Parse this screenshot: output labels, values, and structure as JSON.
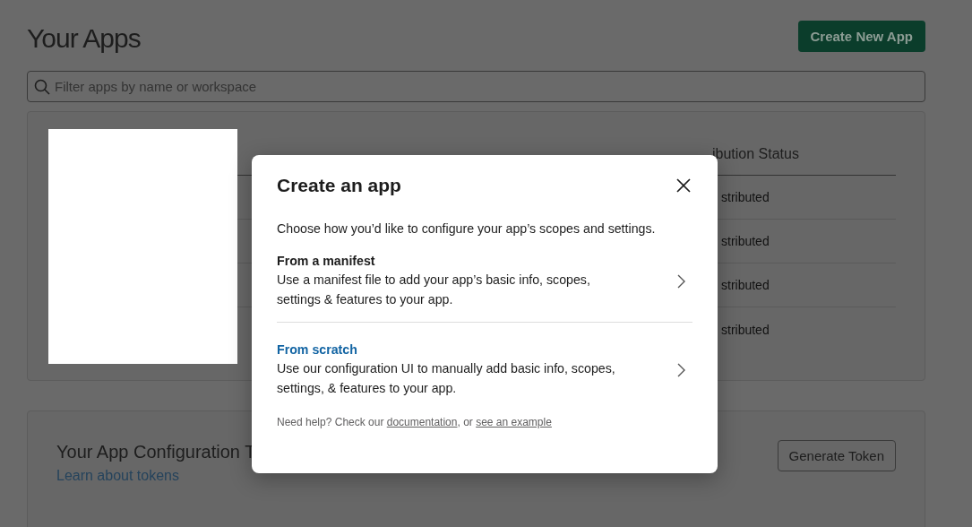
{
  "page": {
    "title": "Your Apps",
    "create_button": "Create New App",
    "search": {
      "placeholder": "Filter apps by name or workspace"
    }
  },
  "apps_table": {
    "visible_header": "ibution Status",
    "visible_cells": [
      "stributed",
      "stributed",
      "stributed",
      "stributed"
    ]
  },
  "tokens_card": {
    "title": "Your App Configuration T",
    "link": "Learn about tokens",
    "button": "Generate Token"
  },
  "dialog": {
    "title": "Create an app",
    "intro": "Choose how you’d like to configure your app’s scopes and settings.",
    "options": [
      {
        "title": "From a manifest",
        "kind": "plain",
        "description": "Use a manifest file to add your app’s basic info, scopes, settings & features to your app."
      },
      {
        "title": "From scratch",
        "kind": "link",
        "description": "Use our configuration UI to manually add basic info, scopes, settings, & features to your app."
      }
    ],
    "help": {
      "before": "Need help? Check our",
      "link_1": "documentation",
      "between": ", or",
      "link_2": "see an example"
    }
  }
}
